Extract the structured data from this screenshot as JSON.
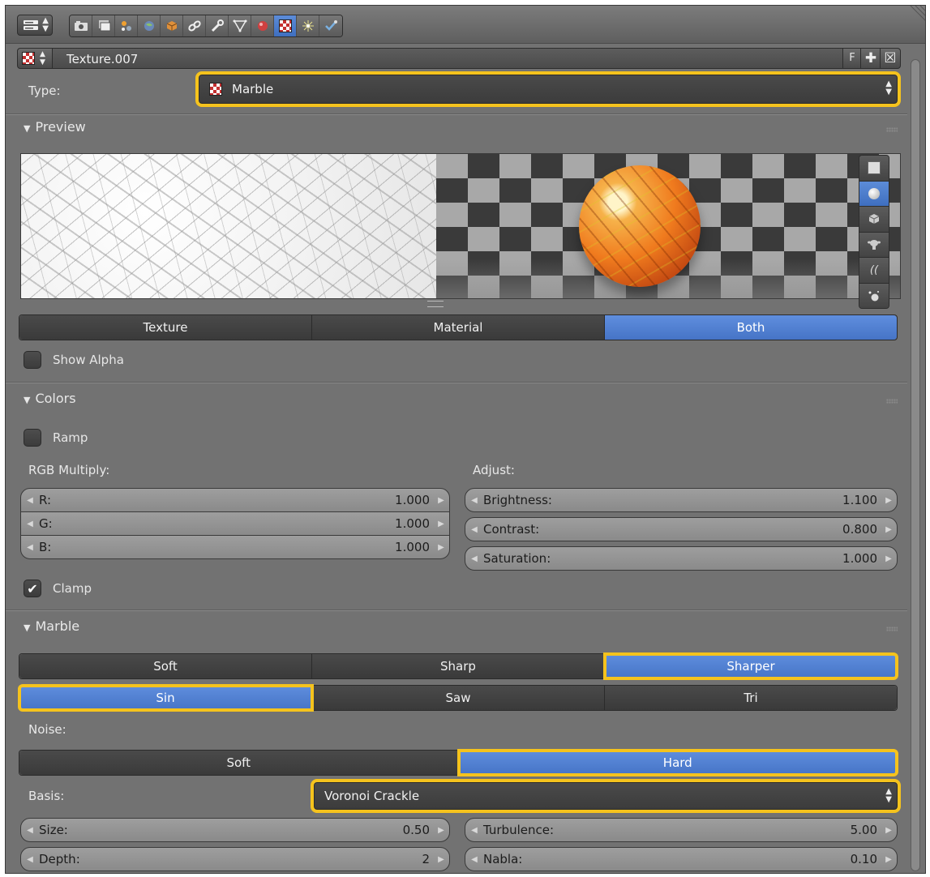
{
  "header": {
    "editor_icon": "properties-editor-icon",
    "context_tabs": [
      {
        "icon": "render-icon",
        "active": false
      },
      {
        "icon": "render-layers-icon",
        "active": false
      },
      {
        "icon": "scene-icon",
        "active": false
      },
      {
        "icon": "world-icon",
        "active": false
      },
      {
        "icon": "object-icon",
        "active": false
      },
      {
        "icon": "constraints-icon",
        "active": false
      },
      {
        "icon": "modifiers-icon",
        "active": false
      },
      {
        "icon": "object-data-icon",
        "active": false
      },
      {
        "icon": "material-icon",
        "active": false
      },
      {
        "icon": "texture-icon",
        "active": true
      },
      {
        "icon": "particles-icon",
        "active": false
      },
      {
        "icon": "physics-icon",
        "active": false
      }
    ]
  },
  "id_block": {
    "name": "Texture.007",
    "fake_user_label": "F"
  },
  "type_row": {
    "label": "Type:",
    "value": "Marble"
  },
  "preview_panel": {
    "title": "Preview",
    "shapes": [
      "plane-icon",
      "sphere-icon",
      "cube-icon",
      "monkey-icon",
      "hair-icon",
      "sphere-sky-icon"
    ],
    "active_shape": "sphere-icon",
    "modes": [
      "Texture",
      "Material",
      "Both"
    ],
    "active_mode": "Both",
    "show_alpha_label": "Show Alpha",
    "show_alpha": false
  },
  "colors_panel": {
    "title": "Colors",
    "ramp_label": "Ramp",
    "ramp": false,
    "rgb_label": "RGB Multiply:",
    "adjust_label": "Adjust:",
    "rgb": [
      {
        "label": "R:",
        "value": "1.000"
      },
      {
        "label": "G:",
        "value": "1.000"
      },
      {
        "label": "B:",
        "value": "1.000"
      }
    ],
    "adjust": [
      {
        "label": "Brightness:",
        "value": "1.100"
      },
      {
        "label": "Contrast:",
        "value": "0.800"
      },
      {
        "label": "Saturation:",
        "value": "1.000"
      }
    ],
    "clamp_label": "Clamp",
    "clamp": true
  },
  "marble_panel": {
    "title": "Marble",
    "types": [
      "Soft",
      "Sharp",
      "Sharper"
    ],
    "active_type": "Sharper",
    "bands": [
      "Sin",
      "Saw",
      "Tri"
    ],
    "active_band": "Sin",
    "noise_label": "Noise:",
    "noise_types": [
      "Soft",
      "Hard"
    ],
    "active_noise": "Hard",
    "basis_label": "Basis:",
    "basis_value": "Voronoi Crackle",
    "size": {
      "label": "Size:",
      "value": "0.50"
    },
    "turbulence": {
      "label": "Turbulence:",
      "value": "5.00"
    },
    "depth": {
      "label": "Depth:",
      "value": "2"
    },
    "nabla": {
      "label": "Nabla:",
      "value": "0.10"
    }
  },
  "colors": {
    "highlight": "#f5c31d",
    "active_blue": "#5a8ad8"
  }
}
